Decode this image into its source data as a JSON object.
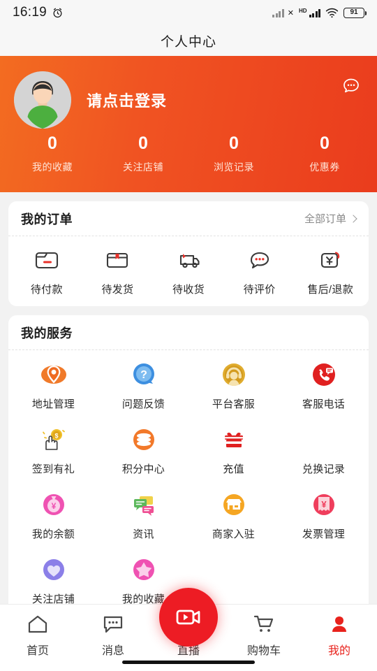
{
  "statusbar": {
    "time": "16:19",
    "alarm_icon": "alarm-clock-icon",
    "hd_label": "HD",
    "battery_level": "91"
  },
  "navbar": {
    "title": "个人中心"
  },
  "header": {
    "login_prompt": "请点击登录",
    "chat_icon": "chat-bubble-icon",
    "avatar": "default-user-avatar",
    "gradient_start": "#f36c21",
    "gradient_end": "#ea3c1d",
    "stats": [
      {
        "value": "0",
        "label": "我的收藏"
      },
      {
        "value": "0",
        "label": "关注店铺"
      },
      {
        "value": "0",
        "label": "浏览记录"
      },
      {
        "value": "0",
        "label": "优惠券"
      }
    ]
  },
  "orders": {
    "title": "我的订单",
    "more_label": "全部订单",
    "items": [
      {
        "label": "待付款",
        "icon": "wallet-icon"
      },
      {
        "label": "待发货",
        "icon": "package-box-icon"
      },
      {
        "label": "待收货",
        "icon": "delivery-truck-icon"
      },
      {
        "label": "待评价",
        "icon": "comment-bubble-icon"
      },
      {
        "label": "售后/退款",
        "icon": "refund-yuan-icon"
      }
    ]
  },
  "services": {
    "title": "我的服务",
    "items": [
      {
        "label": "地址管理",
        "icon": "location-pin-icon",
        "color": "#f2792a"
      },
      {
        "label": "问题反馈",
        "icon": "question-mark-icon",
        "color": "#3d8fe0"
      },
      {
        "label": "平台客服",
        "icon": "headset-support-icon",
        "color": "#d9a22a"
      },
      {
        "label": "客服电话",
        "icon": "phone-call-icon",
        "color": "#e02020"
      },
      {
        "label": "签到有礼",
        "icon": "hand-coin-icon",
        "color": "#e8b92a"
      },
      {
        "label": "积分中心",
        "icon": "coins-stack-icon",
        "color": "#f2792a"
      },
      {
        "label": "充值",
        "icon": "gift-box-icon",
        "color": "#e02020"
      },
      {
        "label": "兑换记录",
        "icon": "none",
        "color": "#cccccc"
      },
      {
        "label": "我的余额",
        "icon": "money-bag-icon",
        "color": "#ef52b2"
      },
      {
        "label": "资讯",
        "icon": "news-chat-icon",
        "color": "#5cb85c"
      },
      {
        "label": "商家入驻",
        "icon": "shop-store-icon",
        "color": "#f5a623"
      },
      {
        "label": "发票管理",
        "icon": "invoice-icon",
        "color": "#ef3e5c"
      },
      {
        "label": "关注店铺",
        "icon": "heart-icon",
        "color": "#8b7fe8"
      },
      {
        "label": "我的收藏",
        "icon": "star-icon",
        "color": "#ef52b2"
      }
    ]
  },
  "tabbar": {
    "active_color": "#e8221c",
    "items": [
      {
        "label": "首页",
        "icon": "home-icon",
        "active": false
      },
      {
        "label": "消息",
        "icon": "message-icon",
        "active": false
      },
      {
        "label": "直播",
        "icon": "live-video-icon",
        "active": false
      },
      {
        "label": "购物车",
        "icon": "cart-icon",
        "active": false
      },
      {
        "label": "我的",
        "icon": "person-icon",
        "active": true
      }
    ]
  }
}
